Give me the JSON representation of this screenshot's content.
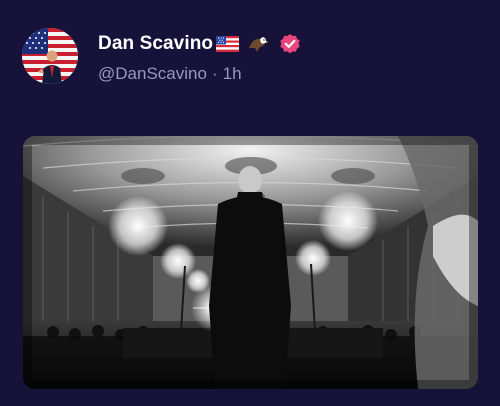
{
  "post": {
    "display_name": "Dan Scavino",
    "handle": "@DanScavino",
    "separator": "·",
    "time": "1h",
    "flag_icon": "us-flag-icon",
    "emoji_icon": "eagle-icon",
    "badge_icon": "verified-badge-icon",
    "badge_color": "#e8467c"
  },
  "colors": {
    "background": "#16123a",
    "meta_text": "#9a97b8"
  }
}
